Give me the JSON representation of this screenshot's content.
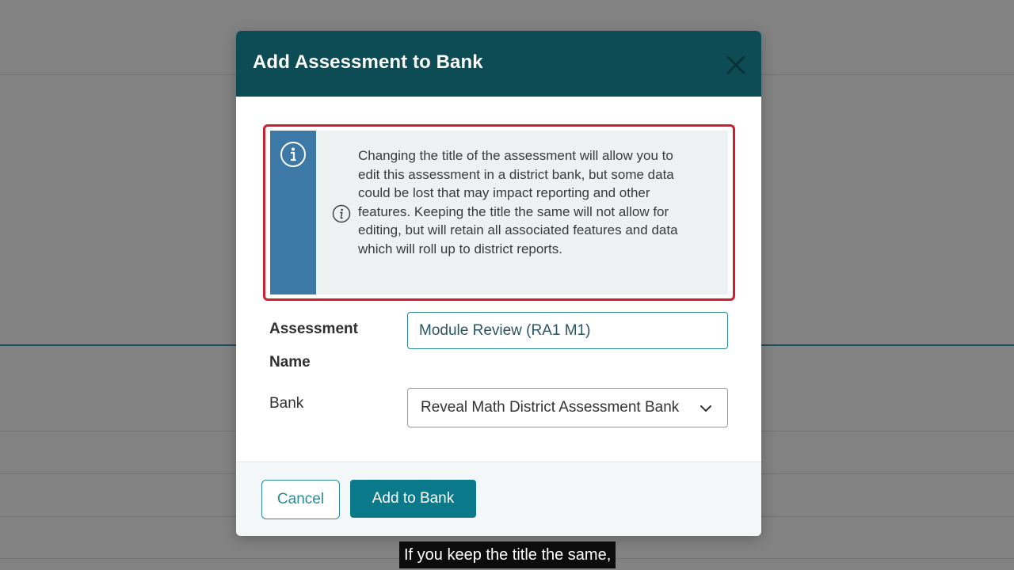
{
  "dialog": {
    "title": "Add Assessment to Bank",
    "close_icon": "close-icon"
  },
  "info": {
    "icon": "info-icon",
    "message": "Changing the title of the assessment will allow you to edit this assessment in a district bank, but some data could be lost that may impact reporting and other features. Keeping the title the same will not allow for editing, but will retain all associated features and data which will roll up to district reports."
  },
  "form": {
    "assessment_name_label_line1": "Assessment",
    "assessment_name_label_line2": "Name",
    "assessment_name_value": "Module Review (RA1 M1)",
    "bank_label": "Bank",
    "bank_selected": "Reveal Math District Assessment Bank"
  },
  "footer": {
    "cancel_label": "Cancel",
    "add_label": "Add to Bank"
  },
  "caption": "If you keep the title the same,",
  "colors": {
    "header": "#0d4b55",
    "info_stripe": "#3d79a6",
    "highlight": "#cc1f2f",
    "accent": "#2b8a95",
    "primary_button": "#0a7a8a"
  }
}
